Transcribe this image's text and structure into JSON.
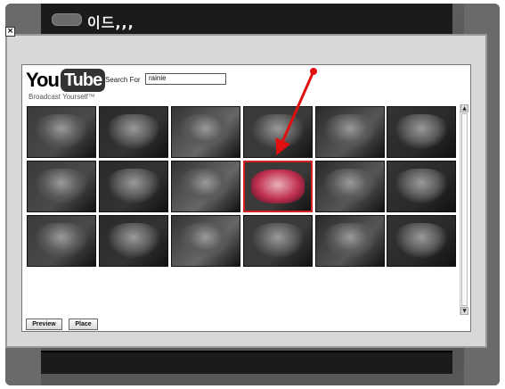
{
  "window": {
    "title": "이드,,,",
    "close_glyph": "×"
  },
  "youtube": {
    "logo_you": "You",
    "logo_tube": "Tube",
    "tagline": "Broadcast Yourself™",
    "search_label": "Search For",
    "search_value": "rainie"
  },
  "results": {
    "selected_index": 9,
    "thumbnail_count": 18
  },
  "buttons": {
    "preview": "Preview",
    "place": "Place"
  },
  "scrollbar": {
    "up_glyph": "▲",
    "down_glyph": "▼"
  },
  "colors": {
    "selection": "#d42020",
    "arrow": "#e01010"
  }
}
